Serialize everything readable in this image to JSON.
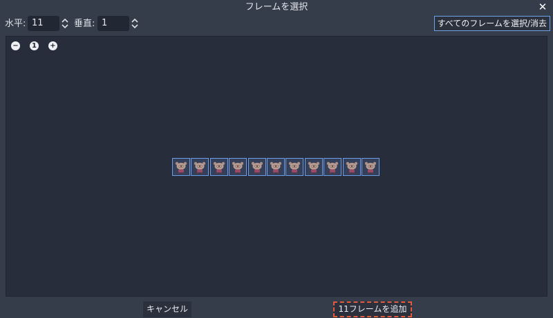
{
  "title": "フレームを選択",
  "close_icon_glyph": "✕",
  "toolbar": {
    "horizontal_label": "水平:",
    "horizontal_value": "11",
    "vertical_label": "垂直:",
    "vertical_value": "1",
    "select_all_label": "すべてのフレームを選択/消去"
  },
  "zoom": {
    "zoom_out_glyph": "−",
    "zoom_reset_glyph": "1",
    "zoom_in_glyph": "+"
  },
  "frames": {
    "count": 11,
    "selected_all": true,
    "border_color": "#6f9fe8"
  },
  "footer": {
    "cancel_label": "キャンセル",
    "add_label": "11フレームを追加"
  },
  "colors": {
    "background": "#363d4a",
    "canvas": "#272d3b",
    "accent": "#6fa4ec",
    "focus_dash": "#e05a3e"
  }
}
